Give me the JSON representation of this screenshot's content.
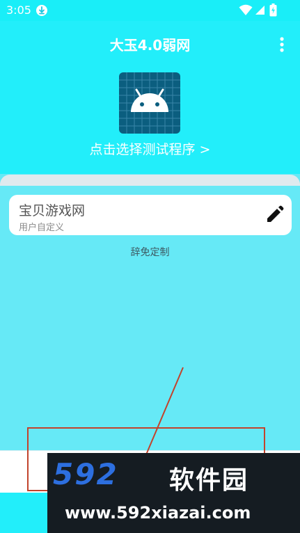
{
  "status_bar": {
    "time": "3:05",
    "icons": [
      "download-icon",
      "wifi-icon",
      "signal-icon",
      "battery-icon"
    ]
  },
  "header": {
    "title": "大玉4.0弱网",
    "menu_icon": "more-vert-icon",
    "app_icon": "android-icon",
    "select_program_label": "点击选择测试程序 >"
  },
  "profile_card": {
    "title": "宝贝游戏网",
    "subtitle": "用户自定义",
    "edit_icon": "edit-pencil-icon"
  },
  "custom_link": "辞免定制",
  "watermark": {
    "logo": "592",
    "name": "软件园",
    "url": "www.592xiazai.com"
  },
  "colors": {
    "primary": "#22eefa",
    "background": "#66e9f6",
    "icon_bg": "#0b5e7f",
    "annotation_red": "#c2432c",
    "watermark_blue": "#2d6fe0"
  }
}
